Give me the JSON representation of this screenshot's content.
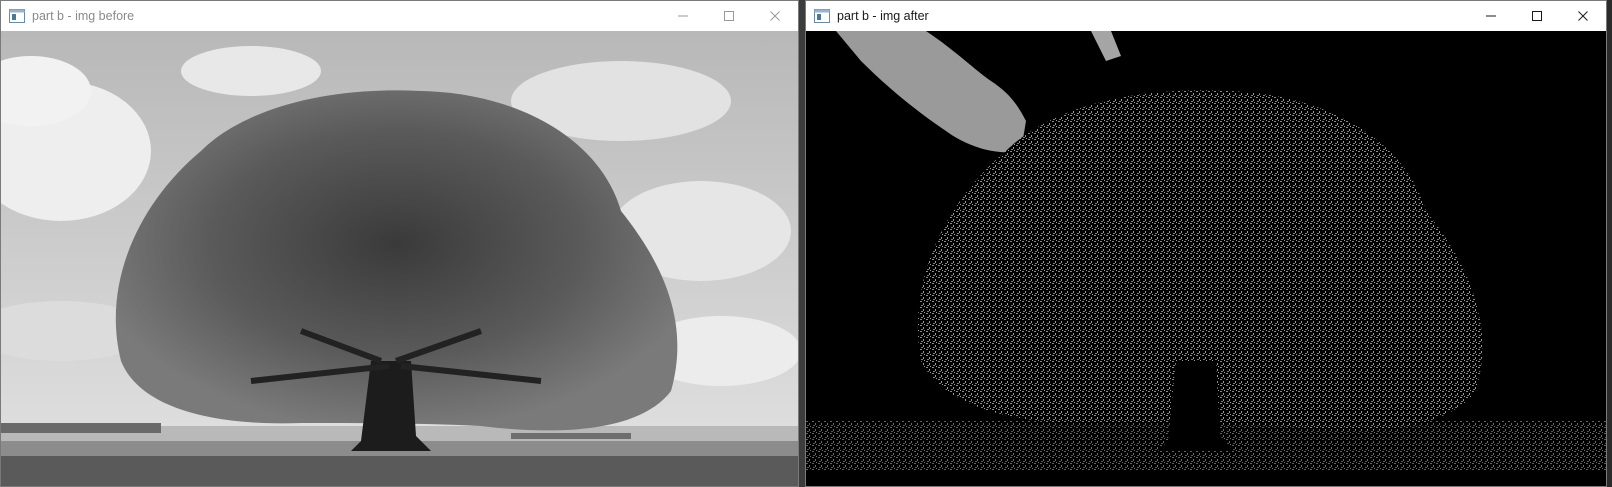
{
  "windows": {
    "before": {
      "title": "part b - img before"
    },
    "after": {
      "title": "part b - img after"
    }
  },
  "icons": {
    "app": "window-app-icon",
    "minimize": "minimize-icon",
    "maximize": "maximize-icon",
    "close": "close-icon"
  }
}
